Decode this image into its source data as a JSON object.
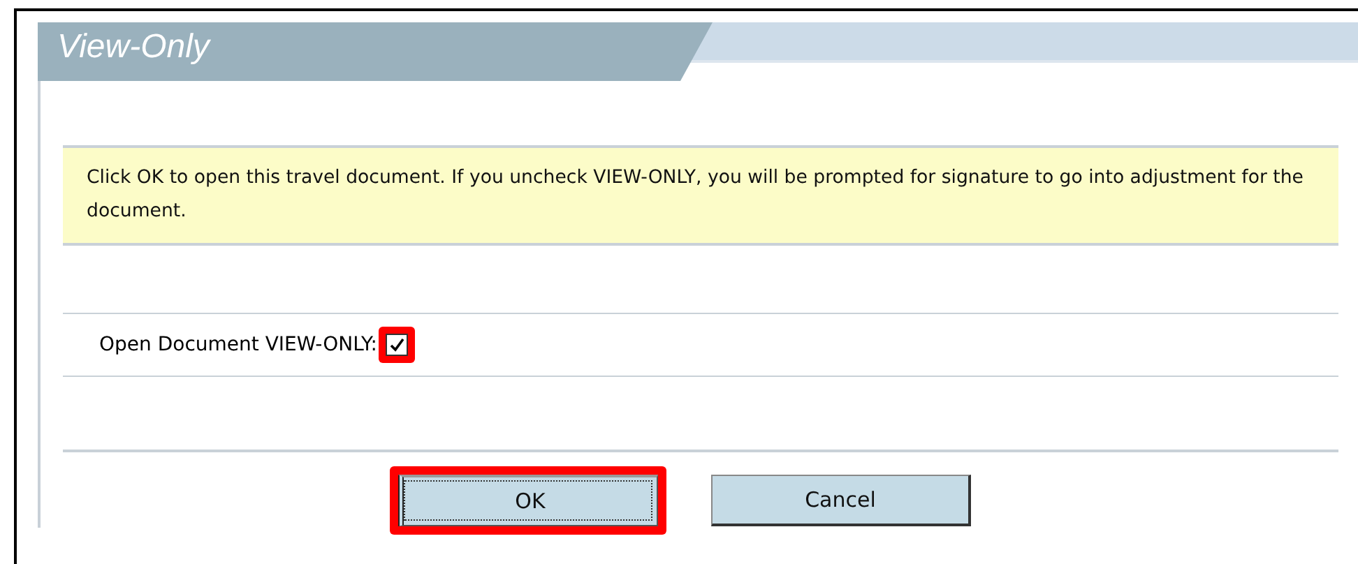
{
  "dialog": {
    "title": "View-Only"
  },
  "notice": "Click OK to open this travel document. If you uncheck VIEW-ONLY, you will be prompted for signature to go into adjustment for the document.",
  "option": {
    "label": "Open Document VIEW-ONLY:",
    "checked": true,
    "highlighted": true
  },
  "buttons": [
    {
      "label": "OK",
      "highlighted": true,
      "focused": true
    },
    {
      "label": "Cancel",
      "highlighted": false,
      "focused": false
    }
  ]
}
